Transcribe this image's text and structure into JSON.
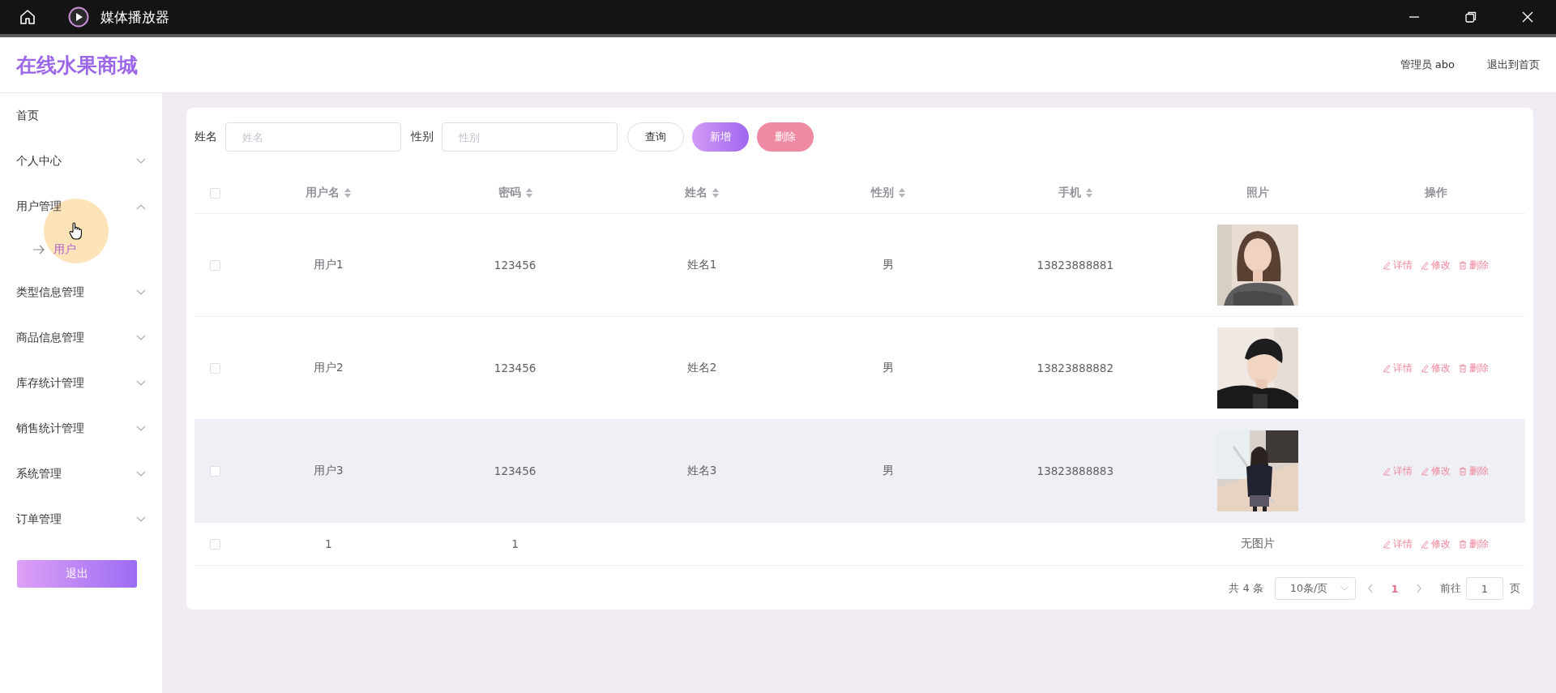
{
  "window": {
    "title": "媒体播放器"
  },
  "header": {
    "logo": "在线水果商城",
    "user": "管理员 abo",
    "exit_link": "退出到首页"
  },
  "sidebar": {
    "items": [
      {
        "label": "首页",
        "kind": "link"
      },
      {
        "label": "个人中心",
        "kind": "menu",
        "expanded": false
      },
      {
        "label": "用户管理",
        "kind": "menu",
        "expanded": true,
        "children": [
          {
            "label": "用户",
            "selected": true
          }
        ]
      },
      {
        "label": "类型信息管理",
        "kind": "menu",
        "expanded": false
      },
      {
        "label": "商品信息管理",
        "kind": "menu",
        "expanded": false
      },
      {
        "label": "库存统计管理",
        "kind": "menu",
        "expanded": false
      },
      {
        "label": "销售统计管理",
        "kind": "menu",
        "expanded": false
      },
      {
        "label": "系统管理",
        "kind": "menu",
        "expanded": false
      },
      {
        "label": "订单管理",
        "kind": "menu",
        "expanded": false
      }
    ],
    "logout_button": "退出"
  },
  "search": {
    "fields": [
      {
        "label": "姓名",
        "placeholder": "姓名"
      },
      {
        "label": "性别",
        "placeholder": "性别"
      }
    ],
    "buttons": [
      {
        "label": "查询",
        "kind": "plain",
        "disabled": false
      },
      {
        "label": "新增",
        "kind": "primary",
        "disabled": false
      },
      {
        "label": "删除",
        "kind": "danger",
        "disabled": true
      }
    ]
  },
  "table": {
    "select_all": {
      "checked": false
    },
    "columns": [
      {
        "label": "用户名",
        "sortable": true
      },
      {
        "label": "密码",
        "sortable": true
      },
      {
        "label": "姓名",
        "sortable": true
      },
      {
        "label": "性别",
        "sortable": true
      },
      {
        "label": "手机",
        "sortable": true
      },
      {
        "label": "照片",
        "sortable": false
      },
      {
        "label": "操作",
        "sortable": false
      }
    ],
    "rows": [
      {
        "checked": false,
        "highlighted": false,
        "cells": [
          "用户1",
          "123456",
          "姓名1",
          "男",
          "13823888881"
        ],
        "photo": {
          "kind": "picture"
        },
        "actions": [
          {
            "label": "详情",
            "kind": "edit"
          },
          {
            "label": "修改",
            "kind": "edit"
          },
          {
            "label": "删除",
            "kind": "delete"
          }
        ]
      },
      {
        "checked": false,
        "highlighted": false,
        "cells": [
          "用户2",
          "123456",
          "姓名2",
          "男",
          "13823888882"
        ],
        "photo": {
          "kind": "picture"
        },
        "actions": [
          {
            "label": "详情",
            "kind": "edit"
          },
          {
            "label": "修改",
            "kind": "edit"
          },
          {
            "label": "删除",
            "kind": "delete"
          }
        ]
      },
      {
        "checked": false,
        "highlighted": true,
        "cells": [
          "用户3",
          "123456",
          "姓名3",
          "男",
          "13823888883"
        ],
        "photo": {
          "kind": "picture"
        },
        "actions": [
          {
            "label": "详情",
            "kind": "edit"
          },
          {
            "label": "修改",
            "kind": "edit"
          },
          {
            "label": "删除",
            "kind": "delete"
          }
        ]
      },
      {
        "checked": false,
        "highlighted": false,
        "cells": [
          "1",
          "1",
          null,
          null,
          null
        ],
        "photo": {
          "kind": "text",
          "text": "无图片"
        },
        "actions": [
          {
            "label": "详情",
            "kind": "edit"
          },
          {
            "label": "修改",
            "kind": "edit"
          },
          {
            "label": "删除",
            "kind": "delete"
          }
        ]
      }
    ]
  },
  "pagination": {
    "total": "共 4 条",
    "page_size": "10条/页",
    "pages": [
      {
        "label": "1",
        "selected": true
      }
    ],
    "goto_label": "前往",
    "goto_value": "1",
    "goto_suffix": "页"
  }
}
